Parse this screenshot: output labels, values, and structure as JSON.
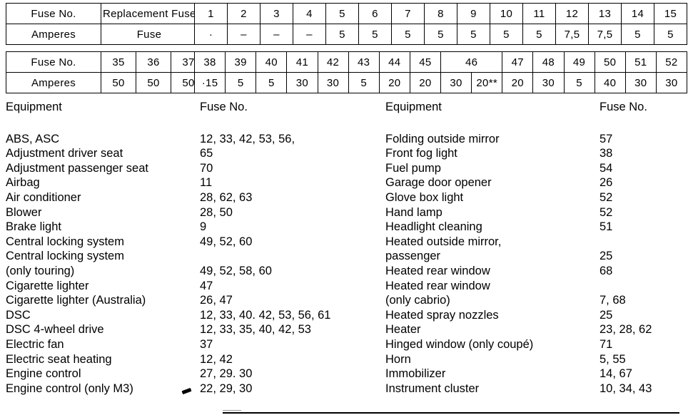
{
  "legend_table": {
    "rows": [
      {
        "label": "Fuse No.",
        "value": "Replacement Fuse"
      },
      {
        "label": "Amperes",
        "value": "Fuse"
      }
    ]
  },
  "amperes_table_left": {
    "row_labels": [
      "Fuse No.",
      "Amperes"
    ],
    "fuse_numbers": [
      "35",
      "36",
      "37"
    ],
    "amperes": [
      "50",
      "50",
      "50"
    ]
  },
  "fuse_table_top": {
    "fuse_numbers": [
      "1",
      "2",
      "3",
      "4",
      "5",
      "6",
      "7",
      "8",
      "9",
      "10",
      "11",
      "12",
      "13",
      "14",
      "15"
    ],
    "amperes": [
      "·",
      "–",
      "–",
      "–",
      "5",
      "5",
      "5",
      "5",
      "5",
      "5",
      "5",
      "7,5",
      "7,5",
      "5",
      "5"
    ]
  },
  "fuse_table_bottom": {
    "fuse_numbers": [
      "38",
      "39",
      "40",
      "41",
      "42",
      "43",
      "44",
      "45",
      "46",
      "47",
      "48",
      "49",
      "50",
      "51",
      "52"
    ],
    "amperes": [
      "·15",
      "5",
      "5",
      "30",
      "30",
      "5",
      "20",
      "20",
      "30",
      "20**",
      "20",
      "30",
      "5",
      "40",
      "30",
      "30"
    ],
    "note": "Fuse 46 spans two amperes cells: 30 and 20**"
  },
  "columns": {
    "equipment_header": "Equipment",
    "fuse_no_header": "Fuse No."
  },
  "left_list": [
    {
      "equipment": "ABS, ASC",
      "fuse": "12, 33, 42, 53, 56,"
    },
    {
      "equipment": "Adjustment driver seat",
      "fuse": "65"
    },
    {
      "equipment": "Adjustment passenger seat",
      "fuse": "70"
    },
    {
      "equipment": "Airbag",
      "fuse": "11"
    },
    {
      "equipment": "Air conditioner",
      "fuse": "28, 62, 63"
    },
    {
      "equipment": "Blower",
      "fuse": "28, 50"
    },
    {
      "equipment": "Brake light",
      "fuse": "9"
    },
    {
      "equipment": "Central locking system",
      "fuse": "49, 52, 60"
    },
    {
      "equipment": "Central locking system",
      "fuse": ""
    },
    {
      "equipment": "(only touring)",
      "fuse": "49, 52, 58, 60"
    },
    {
      "equipment": "Cigarette lighter",
      "fuse": "47"
    },
    {
      "equipment": "Cigarette lighter (Australia)",
      "fuse": "26, 47"
    },
    {
      "equipment": "DSC",
      "fuse": "12, 33, 40. 42, 53, 56, 61"
    },
    {
      "equipment": "DSC 4-wheel drive",
      "fuse": "12, 33, 35, 40, 42, 53"
    },
    {
      "equipment": "Electric fan",
      "fuse": "37"
    },
    {
      "equipment": "Electric seat heating",
      "fuse": "12, 42"
    },
    {
      "equipment": "Engine control",
      "fuse": "27, 29. 30"
    },
    {
      "equipment": "Engine control (only M3)",
      "fuse": "22, 29, 30"
    }
  ],
  "right_list": [
    {
      "equipment": "Folding outside mirror",
      "fuse": "57"
    },
    {
      "equipment": "Front fog light",
      "fuse": "38"
    },
    {
      "equipment": "Fuel pump",
      "fuse": "54"
    },
    {
      "equipment": "Garage door opener",
      "fuse": "26"
    },
    {
      "equipment": "Glove box light",
      "fuse": "52"
    },
    {
      "equipment": "Hand lamp",
      "fuse": "52"
    },
    {
      "equipment": "Headlight cleaning",
      "fuse": "51"
    },
    {
      "equipment": "Heated outside mirror,",
      "fuse": ""
    },
    {
      "equipment": "passenger",
      "fuse": "25"
    },
    {
      "equipment": "Heated rear window",
      "fuse": "68"
    },
    {
      "equipment": "Heated rear window",
      "fuse": ""
    },
    {
      "equipment": "(only cabrio)",
      "fuse": "7, 68"
    },
    {
      "equipment": "Heated spray nozzles",
      "fuse": "25"
    },
    {
      "equipment": "Heater",
      "fuse": "23, 28, 62"
    },
    {
      "equipment": "Hinged window (only coupé)",
      "fuse": "71"
    },
    {
      "equipment": "Horn",
      "fuse": "5, 55"
    },
    {
      "equipment": "Immobilizer",
      "fuse": "14, 67"
    },
    {
      "equipment": "Instrument cluster",
      "fuse": "10, 34, 43"
    }
  ]
}
